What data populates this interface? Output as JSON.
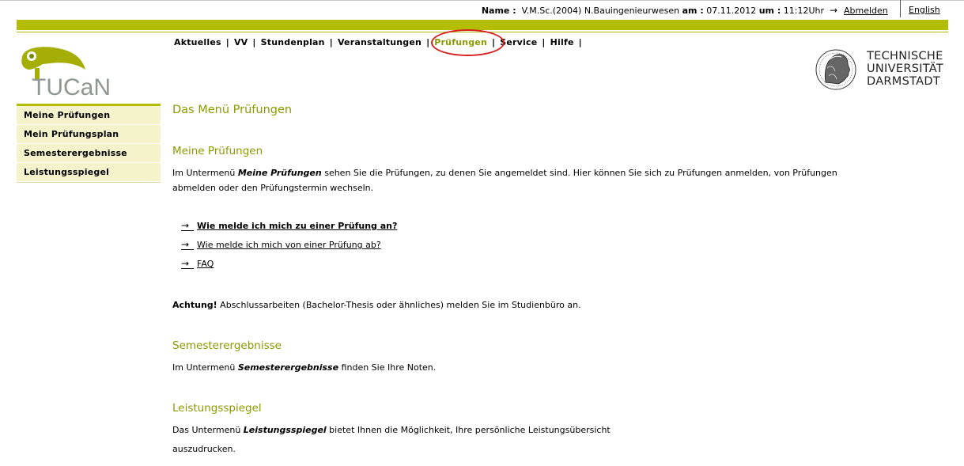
{
  "topbar": {
    "name_label": "Name :",
    "name_value": "V.M.Sc.(2004) N.Bauingenieurwesen",
    "date_label": "am :",
    "date_value": "07.11.2012",
    "time_label": "um :",
    "time_value": "11:12Uhr",
    "logout_arrow": "→",
    "logout_label": "Abmelden",
    "language_label": "English"
  },
  "mainnav": {
    "items": [
      "Aktuelles",
      "VV",
      "Stundenplan",
      "Veranstaltungen",
      "Prüfungen",
      "Service",
      "Hilfe"
    ],
    "separator": "|",
    "active": "Prüfungen"
  },
  "logos": {
    "tucan": "TUCaN",
    "tud_line1": "TECHNISCHE",
    "tud_line2": "UNIVERSITÄT",
    "tud_line3": "DARMSTADT"
  },
  "sidebar": {
    "items": [
      "Meine Prüfungen",
      "Mein Prüfungsplan",
      "Semesterergebnisse",
      "Leistungsspiegel"
    ]
  },
  "content": {
    "title": "Das Menü Prüfungen",
    "section1": {
      "heading": "Meine Prüfungen",
      "text_pre": "Im Untermenü ",
      "text_em": "Meine Prüfungen",
      "text_post": " sehen Sie die Prüfungen, zu denen Sie angemeldet sind. Hier können Sie sich zu Prüfungen anmelden, von Prüfungen",
      "text_line2": "abmelden oder den Prüfungstermin wechseln."
    },
    "links": [
      {
        "arrow": "→",
        "label": "Wie melde ich mich zu einer Prüfung an?"
      },
      {
        "arrow": "→",
        "label": "Wie melde ich mich von einer Prüfung ab?"
      },
      {
        "arrow": "→",
        "label": "FAQ"
      }
    ],
    "notice": {
      "strong": "Achtung!",
      "text": " Abschlussarbeiten (Bachelor-Thesis oder ähnliches) melden Sie im Studienbüro an."
    },
    "section2": {
      "heading": "Semesterergebnisse",
      "text_pre": "Im Untermenü ",
      "text_em": "Semesterergebnisse",
      "text_post": " finden Sie Ihre Noten."
    },
    "section3": {
      "heading": "Leistungsspiegel",
      "text_pre": "Das Untermenü ",
      "text_em": "Leistungsspiegel",
      "text_post": " bietet Ihnen die Möglichkeit, Ihre persönliche Leistungsübersicht",
      "text_line2": "auszudrucken."
    }
  },
  "colors": {
    "brand_green": "#b3bd05",
    "heading_green": "#8a9a00",
    "sidebar_bg": "#f4f3cc",
    "highlight_circle": "#d62020"
  }
}
